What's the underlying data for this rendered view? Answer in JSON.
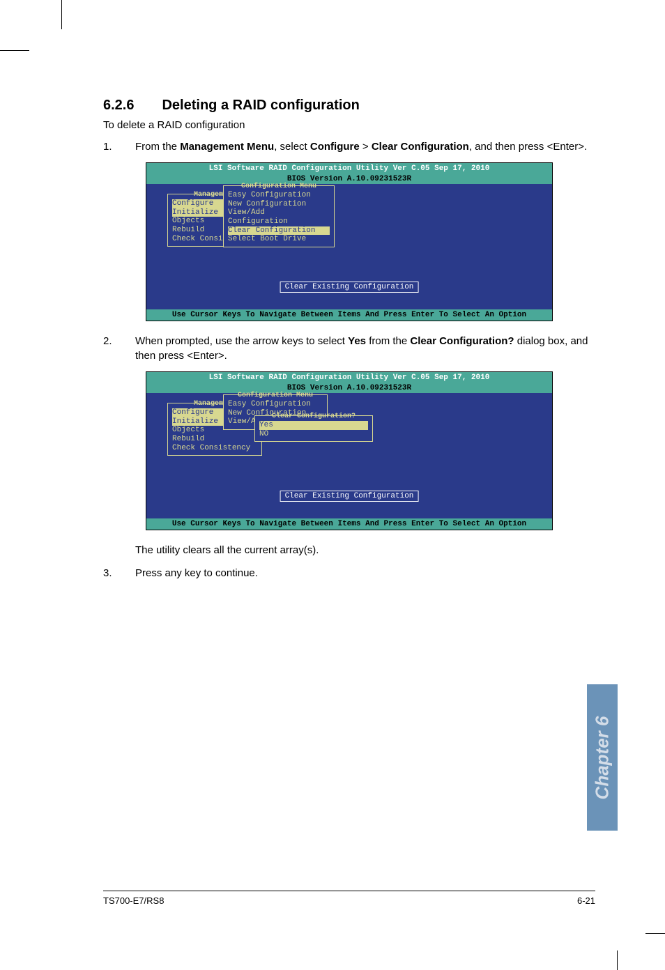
{
  "heading": {
    "number": "6.2.6",
    "title": "Deleting a RAID configuration"
  },
  "intro": "To delete a RAID configuration",
  "steps": {
    "s1": {
      "num": "1.",
      "p1": "From the ",
      "b1": "Management Menu",
      "p2": ", select ",
      "b2": "Configure",
      "p3": " > ",
      "b3": "Clear Configuration",
      "p4": ", and then press <Enter>."
    },
    "s2": {
      "num": "2.",
      "p1": "When prompted, use the arrow keys to select ",
      "b1": "Yes",
      "p2": " from the ",
      "b2": "Clear Configuration?",
      "p3": " dialog box, and then press <Enter>."
    },
    "s2b": "The utility clears all the current array(s).",
    "s3": {
      "num": "3.",
      "text": "Press any key to continue."
    }
  },
  "bios1": {
    "header": "LSI Software RAID Configuration Utility Ver C.05 Sep 17, 2010",
    "version": "BIOS Version   A.10.09231523R",
    "mgmt_title": "Management",
    "mgmt_items": {
      "i1": "Configure",
      "i2": "Initialize",
      "i3": "Objects",
      "i4": "Rebuild",
      "i5": "Check Consistency"
    },
    "cfg_title": "Configuration Menu",
    "cfg_items": {
      "i1": "Easy Configuration",
      "i2": "New Configuration",
      "i3": "View/Add",
      "i4": "Configuration",
      "i5": "Clear Configuration",
      "i6": "Select Boot Drive"
    },
    "status": "Clear Existing Configuration",
    "footer": "Use Cursor Keys To Navigate Between Items And Press Enter To Select An Option"
  },
  "bios2": {
    "header": "LSI Software RAID Configuration Utility Ver C.05 Sep 17, 2010",
    "version": "BIOS Version   A.10.09231523R",
    "mgmt_title": "Management",
    "mgmt_items": {
      "i1": "Configure",
      "i2": "Initialize",
      "i3": "Objects",
      "i4": "Rebuild",
      "i5": "Check Consistency"
    },
    "cfg_title": "Configuration Menu",
    "cfg_items": {
      "i1": "Easy  Configuration",
      "i2": "New  Configuration",
      "i3": "View/A"
    },
    "dlg_title": "Clear Configuration?",
    "dlg_items": {
      "i1": "Yes",
      "i2": "NO"
    },
    "status": "Clear Existing Configuration",
    "footer": "Use Cursor Keys To Navigate Between Items And Press Enter To Select An Option"
  },
  "chapter_tab": "Chapter 6",
  "footer": {
    "left": "TS700-E7/RS8",
    "right": "6-21"
  }
}
